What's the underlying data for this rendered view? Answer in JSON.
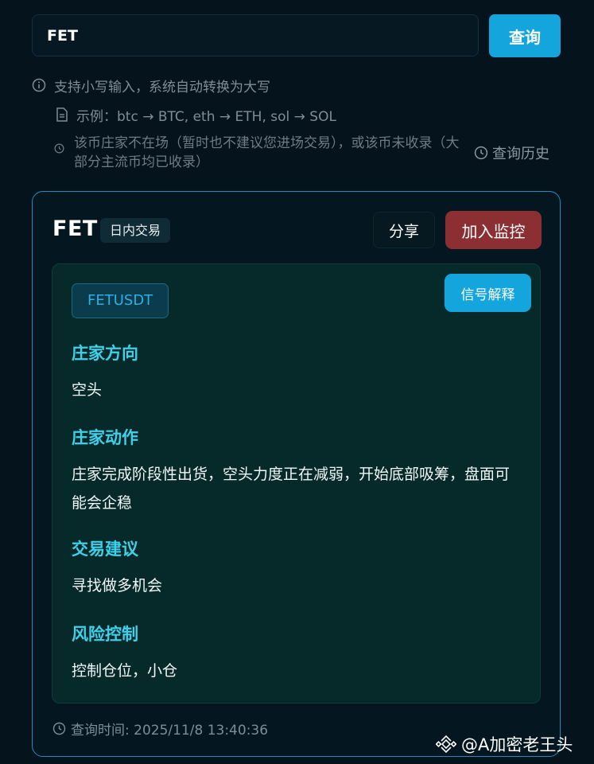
{
  "search": {
    "value": "FET",
    "button_label": "查询"
  },
  "hints": {
    "lowercase": "支持小写输入，系统自动转换为大写",
    "example": "示例：btc → BTC, eth → ETH, sol → SOL",
    "not_found": "该币庄家不在场（暂时也不建议您进场交易），或该币未收录（大部分主流币均已收录）"
  },
  "history_label": "查询历史",
  "result": {
    "coin": "FET",
    "badge": "日内交易",
    "share_label": "分享",
    "monitor_label": "加入监控",
    "pair": "FETUSDT",
    "explain_label": "信号解释",
    "sections": [
      {
        "title": "庄家方向",
        "body": "空头"
      },
      {
        "title": "庄家动作",
        "body": "庄家完成阶段性出货，空头力度正在减弱，开始底部吸筹，盘面可能会企稳"
      },
      {
        "title": "交易建议",
        "body": "寻找做多机会"
      },
      {
        "title": "风险控制",
        "body": "控制仓位，小仓"
      }
    ],
    "query_time": "查询时间: 2025/11/8 13:40:36"
  },
  "watermark": "@A加密老王头",
  "icons": {
    "info": "info-icon",
    "document": "document-icon",
    "clock": "clock-icon",
    "binance": "binance-logo-icon"
  },
  "colors": {
    "background": "#04131c",
    "accent_blue": "#14a5dc",
    "danger_red": "#8c2f33",
    "section_title": "#3fd0ea",
    "card_border": "#1a8fbf"
  }
}
